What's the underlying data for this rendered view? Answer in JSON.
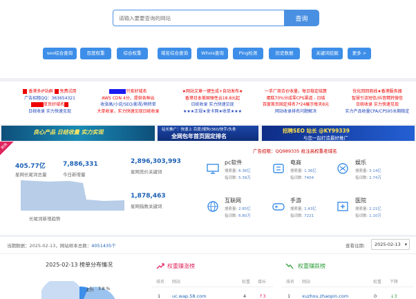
{
  "search": {
    "placeholder": "请输入要要查询的网站",
    "button": "查询"
  },
  "nav": [
    "seo综合查询",
    "百度权重",
    "综合权重",
    "域名综合查询",
    "Whois查询",
    "Ping检测",
    "历史数据",
    "关键词挖掘",
    "更多 >"
  ],
  "ads": [
    {
      "lines": [
        "香港多IP站群",
        "免费试用",
        "广告招租QQ：363654321",
        "单页好域名",
        "日统收录 实力快速见现"
      ]
    },
    {
      "lines": [
        "只卖好域名",
        "AWS CDN 4分，提供各种云",
        "收涨高/小说/SEO/影视/稍转单",
        "大单收录，实力快速见现日统收录"
      ]
    },
    {
      "lines": [
        "★网站文章一键生成+自动发布★",
        "香港日本美国弹性云18.8元起",
        "日统收录 实力快速见现",
        "★★★正规★发卡网★收单★★★"
      ]
    },
    {
      "lines": [
        "一手厂商合价收量，每日稳定结算",
        "蛋糕70%分成零CPS渠道 - 日结",
        "百度首页固定排名7*24展示每天8元",
        "网站收录排名问题解决"
      ]
    },
    {
      "lines": [
        "优化回回商线★香港服务器",
        "智慧引流短信/抖音精转微信",
        "日统收录 实力快速见现",
        "实力产品收量CPA/CPS95长期稳定"
      ]
    }
  ],
  "banners": [
    {
      "text": "良心产品  日结收量  实力实现"
    },
    {
      "text": "站长推广：快速上 百度/搜狗/360/快手/头条",
      "text2": "全网包年首页固定排名"
    },
    {
      "text": "招聘SEO 站长  @KY99339",
      "text2": "与您一起打造最好推广"
    }
  ],
  "stats": {
    "badge": "新闻",
    "v1": "405.77亿",
    "l1": "星网长尾词总量",
    "v2": "7,886,331",
    "l2": "今日新增量",
    "v3": "2,896,303,993",
    "l3": "星网竞价关键词",
    "v4": "1,878,463",
    "l4": "星网指数关键词",
    "trend": "长尾词新增趋势",
    "ad": "广告招租：QQ989335  抢注高权重老域名",
    "cats": [
      {
        "name": "pc软件",
        "s1": "6.36亿",
        "s2": "5.39万"
      },
      {
        "name": "电商",
        "s1": "1.36亿",
        "s2": "7404"
      },
      {
        "name": "娱乐",
        "s1": "3.14亿",
        "s2": "2.74万"
      },
      {
        "name": "互联网",
        "s1": "2.85亿",
        "s2": "6.80万"
      },
      {
        "name": "手游",
        "s1": "1.43亿",
        "s2": "7221"
      },
      {
        "name": "医院",
        "s1": "2.21亿",
        "s2": "1.10万"
      }
    ],
    "sub1": "搜索量:",
    "sub2": "指词数:"
  },
  "bottom": {
    "current_label": "当期数据：2025-02-13，网站样本总数：",
    "total": "4051435个",
    "date_label": "查看往期:",
    "date_value": "2025-02-13",
    "chart_title": "2025-02-13 榜单分布情况",
    "pie_label": "上升",
    "pie_pct": "3.8 %",
    "rise_title": "权重赚涨榜",
    "fall_title": "权重赚跌榜",
    "rise_cols": [
      "排名",
      "网站",
      "权重",
      "增长"
    ],
    "fall_cols": [
      "排名",
      "网站",
      "权重",
      "下降"
    ],
    "rise_row": {
      "rank": "1",
      "site": "uc.wap.58.com",
      "w": "4",
      "d": "↑3"
    },
    "fall_row": {
      "rank": "1",
      "site": "xuzhou.zhaopin.com",
      "w": "0",
      "d": "↓3"
    }
  }
}
